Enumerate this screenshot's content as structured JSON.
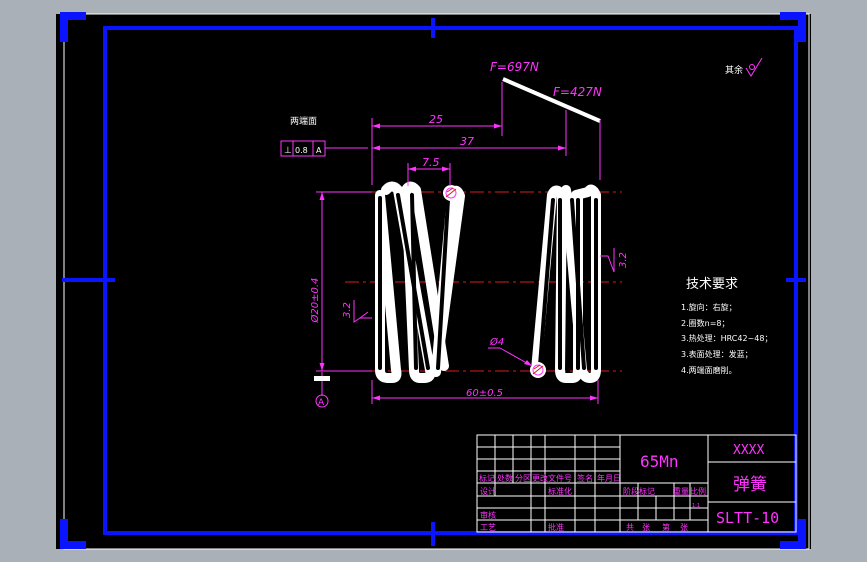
{
  "viewport": {
    "width": 867,
    "height": 562
  },
  "colors": {
    "background_gray": "#a9b0b7",
    "canvas": "#000000",
    "frame_blue": "#0a14ff",
    "dimension_magenta": "#ff33ff",
    "centerline_red": "#d81c1c",
    "outline_white": "#ffffff"
  },
  "drawing": {
    "forces": {
      "f1": "F=697N",
      "f2": "F=427N"
    },
    "dimensions": {
      "d25": "25",
      "d37": "37",
      "d7_5": "7.5",
      "d_outer": "Ø20±0.4",
      "d_wire": "Ø4",
      "d_length": "60±0.5",
      "roughness_left": "3.2",
      "roughness_right": "3.2"
    },
    "tolerance": {
      "label": "两端面",
      "symbol": "⊥",
      "value": "0.8",
      "datum": "A"
    },
    "datum_label": "A",
    "surface_note": "其余"
  },
  "requirements": {
    "title": "技术要求",
    "items": [
      "1.旋向：右旋；",
      "2.圈数n=8；",
      "3.热处理：HRC42~48；",
      "3.表面处理：发蓝；",
      "4.两端面磨削。"
    ]
  },
  "title_block": {
    "material": "65Mn",
    "company": "XXXX",
    "part_name": "弹簧",
    "drawing_number": "SLTT-10",
    "headers": {
      "mark": "标记",
      "count": "处数",
      "zone": "分区",
      "change_doc": "更改文件号",
      "signature": "签名",
      "date": "年月日",
      "design": "设计",
      "standardize": "标准化",
      "review": "审核",
      "process": "工艺",
      "approve": "批准",
      "stage_mark": "阶段标记",
      "weight": "重量",
      "scale": "比例",
      "sheet_total": "共",
      "sheet": "张",
      "sheet_of": "第",
      "sheet_end": "张"
    },
    "scale_value": "1:1"
  }
}
